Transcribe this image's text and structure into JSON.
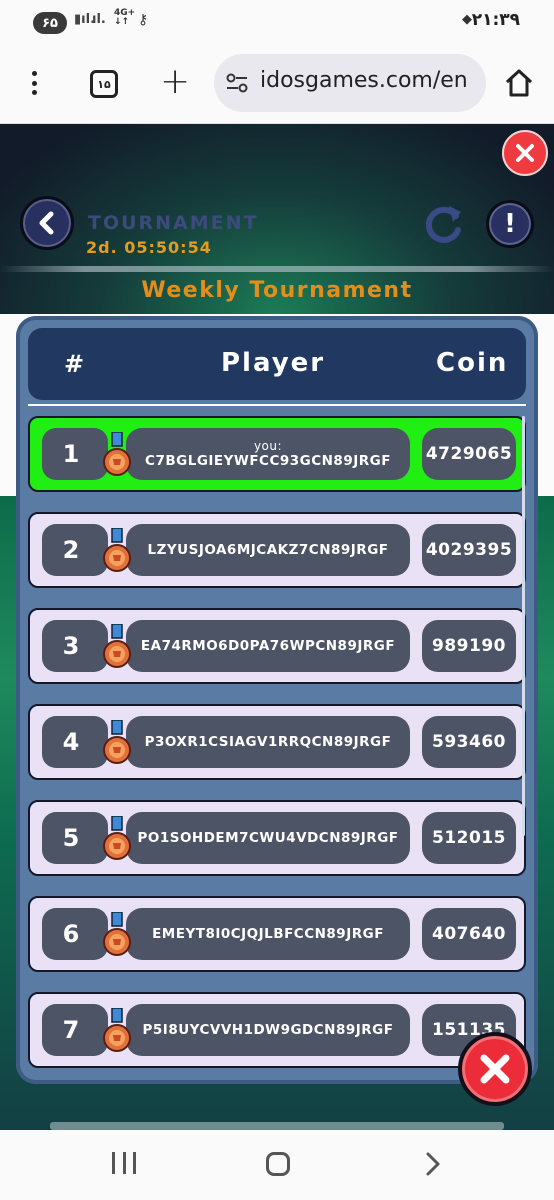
{
  "status_bar": {
    "battery": "۶۵",
    "network": "4G+",
    "time": "۲۱:۳۹"
  },
  "browser": {
    "tab_count": "۱۵",
    "url": "idosgames.com/en"
  },
  "header": {
    "title": "TOURNAMENT",
    "timer": "2d. 05:50:54",
    "info_label": "!"
  },
  "tournament": {
    "title": "Weekly Tournament",
    "columns": {
      "rank": "#",
      "player": "Player",
      "coin": "Coin"
    },
    "rows": [
      {
        "rank": "1",
        "you_label": "you:",
        "player": "C7BGLGIEYWFCC93GCN89JRGF",
        "coin": "4729065"
      },
      {
        "rank": "2",
        "player": "LZYUSJOA6MJCAKZ7CN89JRGF",
        "coin": "4029395"
      },
      {
        "rank": "3",
        "player": "EA74RMO6D0PA76WPCN89JRGF",
        "coin": "989190"
      },
      {
        "rank": "4",
        "player": "P3OXR1CSIAGV1RRQCN89JRGF",
        "coin": "593460"
      },
      {
        "rank": "5",
        "player": "PO1SOHDEM7CWU4VDCN89JRGF",
        "coin": "512015"
      },
      {
        "rank": "6",
        "player": "EMEYT8I0CJQJLBFCCN89JRGF",
        "coin": "407640"
      },
      {
        "rank": "7",
        "player": "P5I8UYCVVH1DW9GDCN89JRGF",
        "coin": "151135"
      }
    ]
  },
  "colors": {
    "current_player_row": "#21ee13",
    "row_background": "#e9e2f7",
    "title_orange": "#e48d1b",
    "close_red": "#ec2c38"
  }
}
